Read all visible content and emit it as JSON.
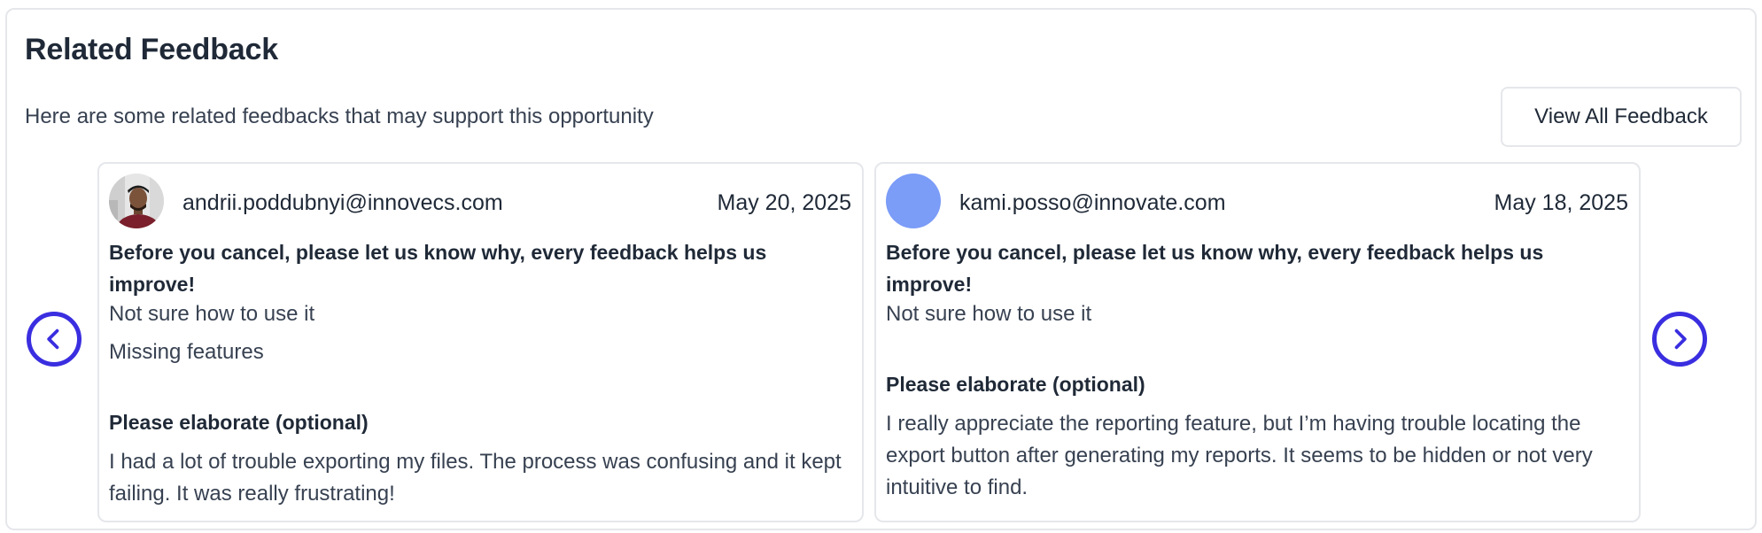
{
  "header": {
    "title": "Related Feedback",
    "subtitle": "Here are some related feedbacks that may support this opportunity",
    "view_all_label": "View All Feedback"
  },
  "navigation": {
    "prev_icon": "chevron-left-icon",
    "next_icon": "chevron-right-icon",
    "accent_color": "#3a2ee0"
  },
  "feedbacks": [
    {
      "email": "andrii.poddubnyi@innovecs.com",
      "date": "May 20, 2025",
      "avatar": "photo-avatar",
      "question": "Before you cancel, please let us know why, every feedback helps us improve!",
      "answers": [
        "Not sure how to use it",
        "Missing features"
      ],
      "elaborate_label": "Please elaborate (optional)",
      "elaborate_text": "I had a lot of trouble exporting my files. The process was confusing and it kept failing. It was really frustrating!"
    },
    {
      "email": "kami.posso@innovate.com",
      "date": "May 18, 2025",
      "avatar": "placeholder-avatar",
      "avatar_color": "#7b9cf7",
      "question": "Before you cancel, please let us know why, every feedback helps us improve!",
      "answers": [
        "Not sure how to use it"
      ],
      "elaborate_label": "Please elaborate (optional)",
      "elaborate_text": "I really appreciate the reporting feature, but I’m having trouble locating the export button after generating my reports. It seems to be hidden or not very intuitive to find."
    }
  ]
}
